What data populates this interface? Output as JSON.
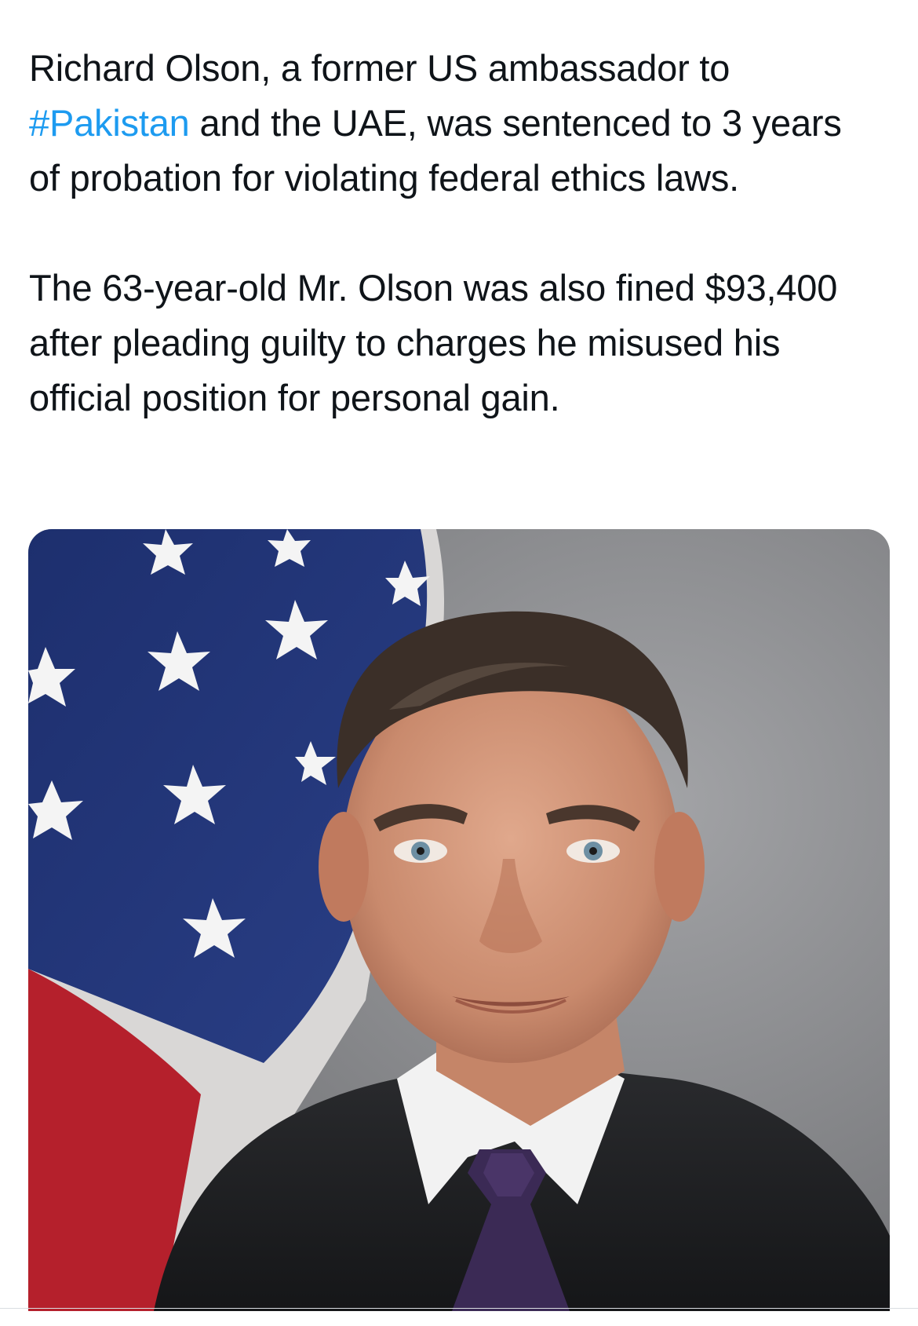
{
  "tweet": {
    "paragraph_1": {
      "before": "Richard Olson, a former US ambassador to ",
      "hashtag": "#Pakistan",
      "after": " and the UAE, was sentenced to 3 years of probation for violating federal ethics laws."
    },
    "paragraph_2": "The 63-year-old Mr. Olson was also fined $93,400 after pleading guilty to charges he misused his official position for personal gain.",
    "link_color": "#1d9bf0",
    "text_color": "#0f1419"
  }
}
